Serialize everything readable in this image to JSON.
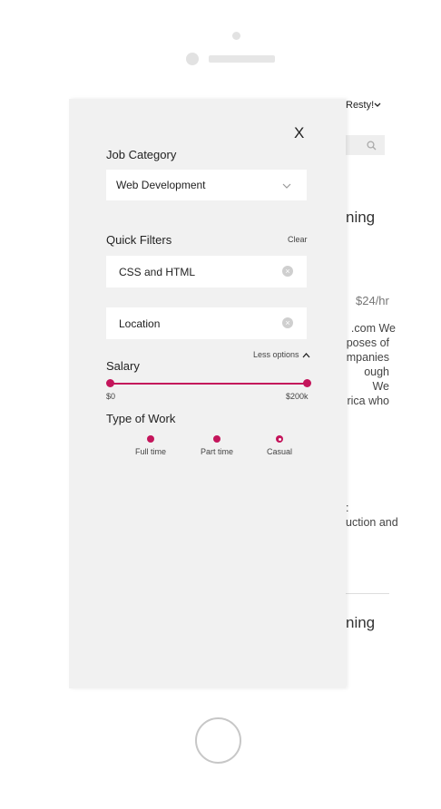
{
  "background_app": {
    "user_label": "Resty!",
    "title_fragment_1": "ning",
    "rate": "$24/hr",
    "desc_lines": [
      ".com We",
      "poses of",
      "mpanies",
      "ough We",
      "rica who"
    ],
    "desc2_line1": ":",
    "desc2_line2": "uction and",
    "title_fragment_2": "ning"
  },
  "filter_panel": {
    "close_label": "X",
    "job_category": {
      "label": "Job Category",
      "selected": "Web Development"
    },
    "quick_filters": {
      "label": "Quick Filters",
      "clear_label": "Clear",
      "keyword_value": "CSS and HTML",
      "location_placeholder": "Location"
    },
    "less_options_label": "Less options",
    "salary": {
      "label": "Salary",
      "min_label": "$0",
      "max_label": "$200k",
      "range_fraction": [
        0,
        1
      ]
    },
    "type_of_work": {
      "label": "Type of Work",
      "options": [
        {
          "label": "Full time",
          "selected": false
        },
        {
          "label": "Part time",
          "selected": false
        },
        {
          "label": "Casual",
          "selected": true
        }
      ]
    }
  },
  "colors": {
    "accent": "#c4155b",
    "panel_bg": "#f1f1f1"
  }
}
